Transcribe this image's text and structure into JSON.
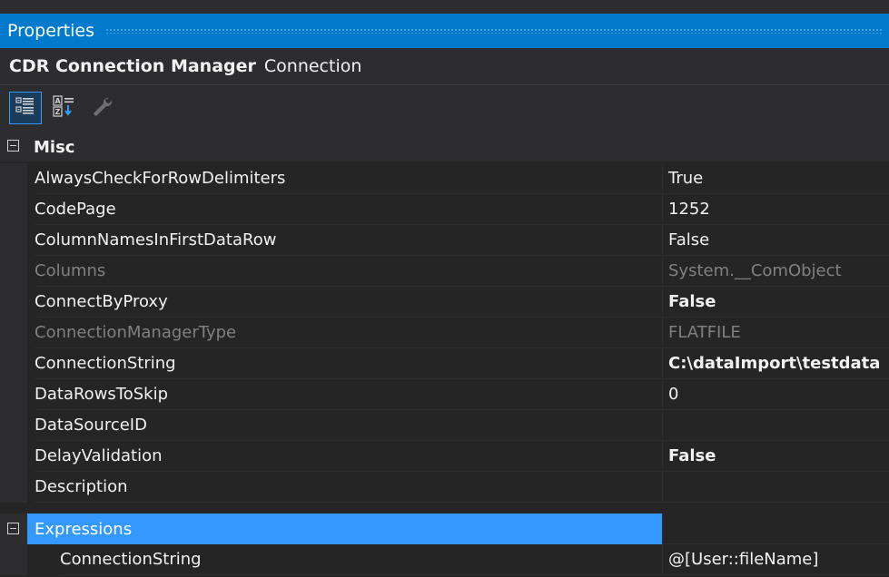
{
  "window": {
    "title": "Properties"
  },
  "object": {
    "name": "CDR Connection Manager",
    "type": "Connection"
  },
  "toolbar": {
    "icons": [
      "categorized-icon",
      "alphabetical-icon",
      "property-pages-icon"
    ]
  },
  "categories": [
    {
      "label": "Misc",
      "properties": [
        {
          "name": "AlwaysCheckForRowDelimiters",
          "value": "True"
        },
        {
          "name": "CodePage",
          "value": "1252"
        },
        {
          "name": "ColumnNamesInFirstDataRow",
          "value": "False"
        },
        {
          "name": "Columns",
          "value": "System.__ComObject"
        },
        {
          "name": "ConnectByProxy",
          "value": "False"
        },
        {
          "name": "ConnectionManagerType",
          "value": "FLATFILE"
        },
        {
          "name": "ConnectionString",
          "value": "C:\\dataImport\\testdata"
        },
        {
          "name": "DataRowsToSkip",
          "value": "0"
        },
        {
          "name": "DataSourceID",
          "value": ""
        },
        {
          "name": "DelayValidation",
          "value": "False"
        },
        {
          "name": "Description",
          "value": ""
        }
      ]
    },
    {
      "label": "Expressions",
      "properties": [
        {
          "name": "ConnectionString",
          "value": "@[User::fileName]"
        }
      ]
    }
  ]
}
